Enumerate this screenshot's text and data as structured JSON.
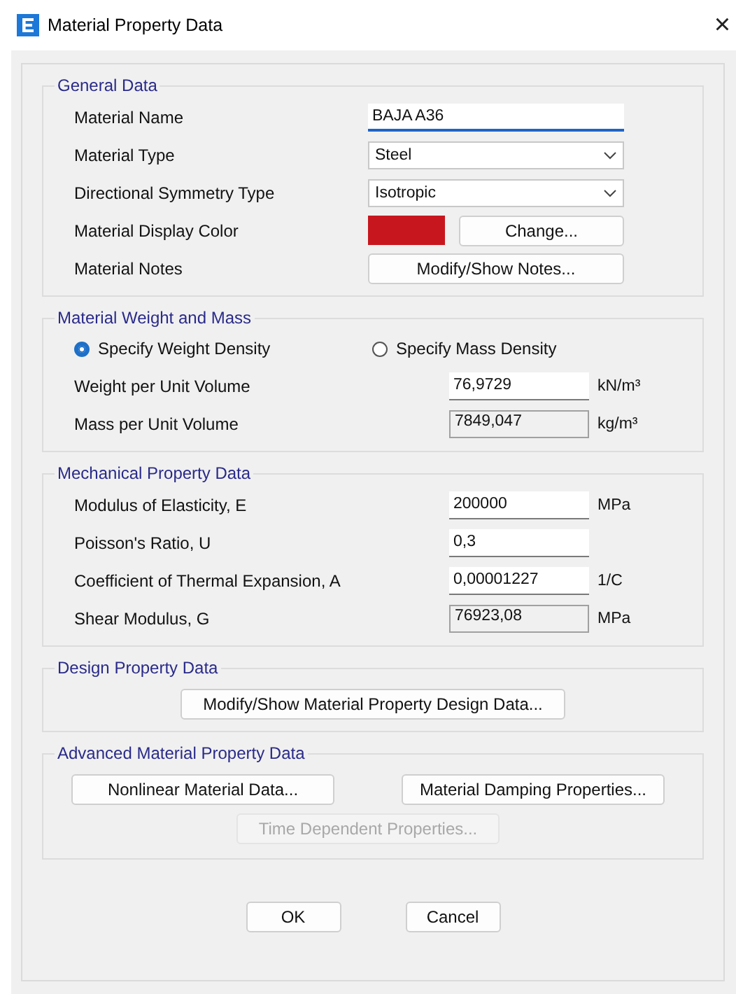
{
  "window": {
    "title": "Material Property Data",
    "close": "×"
  },
  "general": {
    "title": "General Data",
    "rows": [
      {
        "kind": "text",
        "label": "Material Name",
        "value": "BAJA A36"
      },
      {
        "kind": "dropdown",
        "label": "Material Type",
        "value": "Steel"
      },
      {
        "kind": "dropdown",
        "label": "Directional Symmetry Type",
        "value": "Isotropic"
      },
      {
        "kind": "color",
        "label": "Material Display Color",
        "color": "#c8161e",
        "button": "Change..."
      },
      {
        "kind": "button",
        "label": "Material Notes",
        "button": "Modify/Show Notes..."
      }
    ]
  },
  "weight": {
    "title": "Material Weight and Mass",
    "options": [
      {
        "label": "Specify Weight Density",
        "selected": true
      },
      {
        "label": "Specify Mass Density",
        "selected": false
      }
    ],
    "rows": [
      {
        "label": "Weight per Unit Volume",
        "value": "76,9729",
        "unit": "kN/m³",
        "readonly": false
      },
      {
        "label": "Mass per Unit Volume",
        "value": "7849,047",
        "unit": "kg/m³",
        "readonly": true
      }
    ]
  },
  "mechanical": {
    "title": "Mechanical Property Data",
    "rows": [
      {
        "label": "Modulus of Elasticity,  E",
        "value": "200000",
        "unit": "MPa",
        "readonly": false
      },
      {
        "label": "Poisson's Ratio,  U",
        "value": "0,3",
        "readonly": false
      },
      {
        "label": "Coefficient of Thermal Expansion,  A",
        "value": "0,00001227",
        "unit": "1/C",
        "readonly": false
      },
      {
        "label": "Shear Modulus,  G",
        "value": "76923,08",
        "unit": "MPa",
        "readonly": true
      }
    ]
  },
  "design": {
    "title": "Design Property Data",
    "button": "Modify/Show Material Property Design Data..."
  },
  "advanced": {
    "title": "Advanced Material Property Data",
    "buttons": [
      {
        "label": "Nonlinear Material Data...",
        "disabled": false
      },
      {
        "label": "Material Damping Properties...",
        "disabled": false
      },
      {
        "label": "Time Dependent Properties...",
        "disabled": true
      }
    ]
  },
  "footer": [
    "OK",
    "Cancel"
  ]
}
